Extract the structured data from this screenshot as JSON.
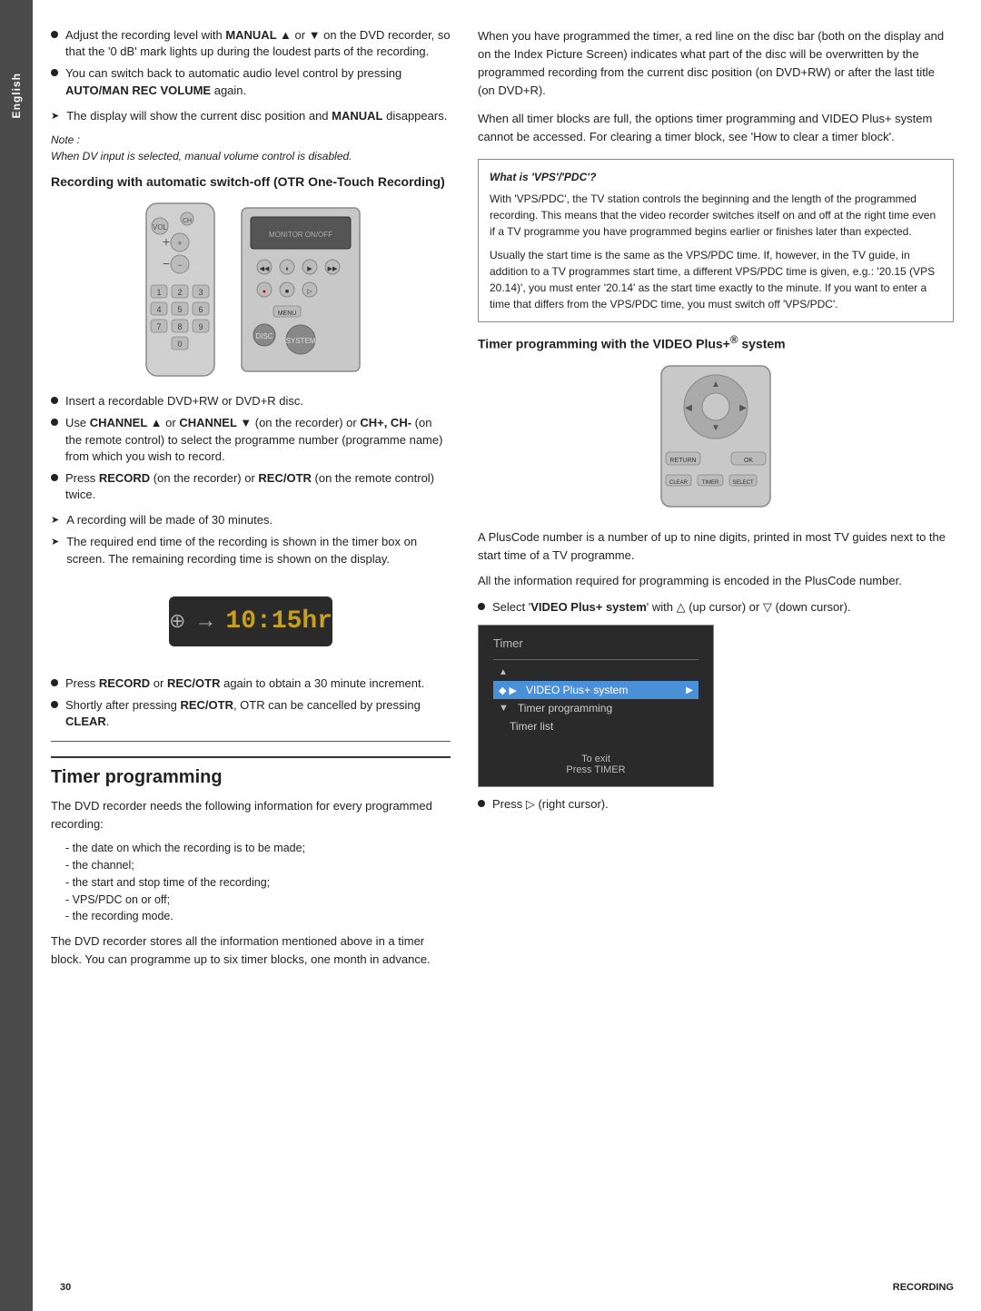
{
  "sidebar": {
    "label": "English"
  },
  "left_column": {
    "bullet_intro": [
      {
        "id": 1,
        "text": "Adjust the recording level with MANUAL ▲ or ▼ on the DVD recorder, so that the '0 dB' mark lights up during the loudest parts of the recording.",
        "bold_parts": [
          "MANUAL"
        ]
      },
      {
        "id": 2,
        "text": "You can switch back to automatic audio level control by pressing AUTO/MAN REC VOLUME again.",
        "bold_parts": [
          "AUTO/MAN REC VOLUME"
        ]
      }
    ],
    "arrow_bullets": [
      "The display will show the current disc position and MANUAL disappears."
    ],
    "note_label": "Note :",
    "note_italic": "When DV input is selected, manual volume control is disabled.",
    "otr_section": {
      "heading": "Recording with automatic switch-off (OTR One-Touch Recording)",
      "bullets": [
        "Insert a recordable DVD+RW or DVD+R disc.",
        "Use CHANNEL ▲ or CHANNEL ▼ (on the recorder) or CH+, CH- (on the remote control) to select the programme number (programme name) from which you wish to record.",
        "Press RECORD (on the recorder) or REC/OTR (on the remote control) twice."
      ],
      "arrow_bullets": [
        "A recording will be made of 30 minutes.",
        "The required end time of the recording is shown in the timer box on screen. The remaining recording time is shown on the display."
      ],
      "otr_display": {
        "icon": "⊕",
        "arrow": "→",
        "time": "10:15hr"
      },
      "bullets2": [
        "Press RECORD or REC/OTR again to obtain a 30 minute increment.",
        "Shortly after pressing REC/OTR, OTR can be cancelled by pressing CLEAR."
      ]
    },
    "timer_section": {
      "heading": "Timer programming",
      "intro": "The DVD recorder needs the following information for every programmed recording:",
      "list_items": [
        "the date on which the recording is to be made;",
        "the channel;",
        "the start and stop time of the recording;",
        "VPS/PDC on or off;",
        "the recording mode."
      ],
      "para2": "The DVD recorder stores all the information mentioned above in a timer block. You can programme up to six timer blocks, one month in advance."
    }
  },
  "right_column": {
    "intro_paras": [
      "When you have programmed the timer, a red line on the disc bar (both on the display and on the Index Picture Screen) indicates what part of the disc will be overwritten by the programmed recording from the current disc position (on DVD+RW) or after the last title (on DVD+R).",
      "When all timer blocks are full, the options timer programming and VIDEO Plus+ system cannot be accessed. For clearing a timer block, see 'How to clear a timer block'."
    ],
    "vps_box": {
      "title": "What is 'VPS'/'PDC'?",
      "paragraphs": [
        "With 'VPS/PDC', the TV station controls the beginning and the length of the programmed recording. This means that the video recorder switches itself on and off at the right time even if a TV programme you have programmed begins earlier or finishes later than expected.",
        "Usually the start time is the same as the VPS/PDC time. If, however, in the TV guide, in addition to a TV programmes start time, a different VPS/PDC time is given, e.g.: '20.15 (VPS 20.14)', you must enter '20.14' as the start time exactly to the minute. If you want to enter a time that differs from the VPS/PDC time, you must switch off 'VPS/PDC'."
      ]
    },
    "video_plus_section": {
      "heading": "Timer programming with the VIDEO Plus+® system",
      "paras": [
        "A PlusCode number is a number of up to nine digits, printed in most TV guides next to the start time of a TV programme.",
        "All the information required for programming is encoded in the PlusCode number."
      ],
      "bullet": "Select 'VIDEO Plus+ system' with △ (up cursor) or ▽ (down cursor).",
      "timer_menu": {
        "title": "Timer",
        "items": [
          {
            "label": "VIDEO Plus+ system",
            "selected": true,
            "has_arrow": true
          },
          {
            "label": "Timer programming",
            "selected": false,
            "sub": false
          },
          {
            "label": "Timer list",
            "selected": false,
            "sub": true
          }
        ],
        "to_exit": "To exit",
        "press_timer": "Press TIMER"
      },
      "final_bullet": "Press ▷ (right cursor)."
    }
  },
  "footer": {
    "page_number": "30",
    "section": "RECORDING"
  }
}
